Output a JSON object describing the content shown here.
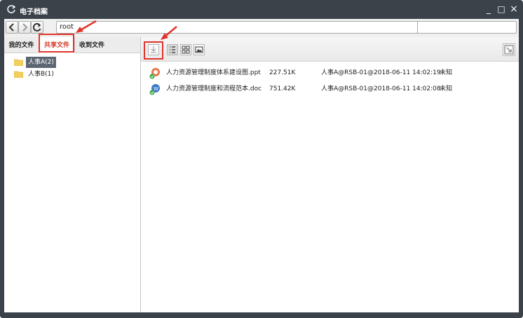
{
  "window": {
    "title": "电子档案",
    "minimize_glyph": "_",
    "maximize_glyph": "□",
    "close_glyph": "×",
    "app_icon": "refresh-icon"
  },
  "navbar": {
    "back_icon": "chevron-left-icon",
    "forward_icon": "chevron-right-icon",
    "refresh_icon": "refresh-icon",
    "address_value": "root",
    "search_value": ""
  },
  "tabs": [
    {
      "label": "我的文件",
      "active": false
    },
    {
      "label": "共享文件",
      "active": true
    },
    {
      "label": "收到文件",
      "active": false
    }
  ],
  "tree": [
    {
      "label": "人事A(2)",
      "selected": true
    },
    {
      "label": "人事B(1)",
      "selected": false
    }
  ],
  "toolbar": {
    "download_icon": "download-icon",
    "list_view_icon": "list-view-icon",
    "grid_view_icon": "grid-view-icon",
    "image_view_icon": "image-view-icon",
    "export_icon": "export-icon"
  },
  "files": [
    {
      "name": "人力资源管理制度体系建设图.ppt",
      "size": "227.51K",
      "owner": "人事A@RSB-01@2018-06-11 14:02:19",
      "status": "未知",
      "type": "ppt"
    },
    {
      "name": "人力资源管理制度和流程范本.doc",
      "size": "751.42K",
      "owner": "人事A@RSB-01@2018-06-11 14:02:08",
      "status": "未知",
      "type": "doc"
    }
  ],
  "colors": {
    "titlebar": "#3b424a",
    "highlight": "#e0342a",
    "selected": "#5c6672",
    "active_tab_text": "#d23a2a"
  }
}
